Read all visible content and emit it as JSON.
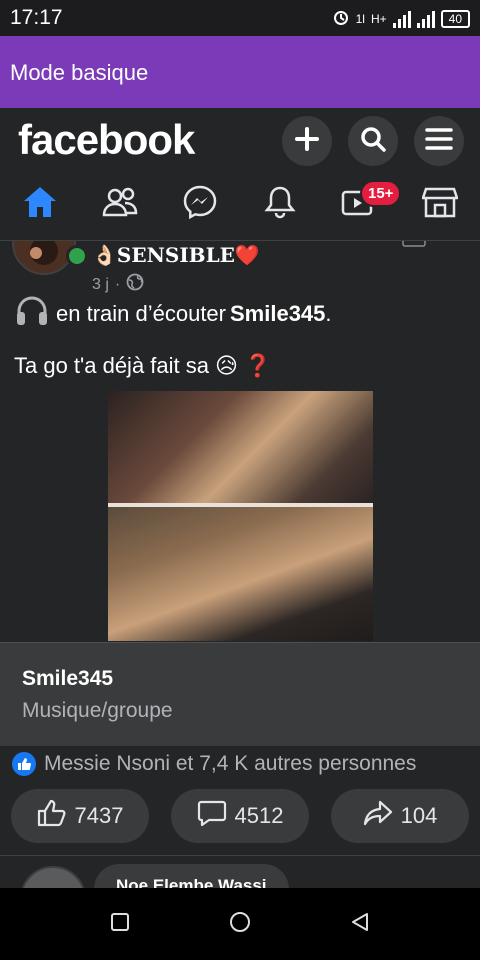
{
  "status_bar": {
    "time": "17:17",
    "network": "H+",
    "data": "1l",
    "battery": "40"
  },
  "mode_bar": {
    "label": "Mode basique"
  },
  "header": {
    "logo": "facebook",
    "actions": [
      "plus-icon",
      "search-icon",
      "menu-icon"
    ],
    "nav": [
      {
        "icon": "home-icon",
        "active": true
      },
      {
        "icon": "friends-icon"
      },
      {
        "icon": "messenger-icon"
      },
      {
        "icon": "bell-icon"
      },
      {
        "icon": "watch-icon",
        "badge": "15+"
      },
      {
        "icon": "marketplace-icon"
      }
    ]
  },
  "post": {
    "author": "SENSIBLE",
    "author_prefix_emoji": "👌🏻",
    "author_suffix_emoji": "❤️",
    "time": "3 j",
    "visibility": "public",
    "listening_text": "en train d’écouter",
    "listening_artist": "Smile345",
    "listening_period": ".",
    "body_text": "Ta go t'a déjà fait sa",
    "body_emoji_1": "😥",
    "body_emoji_2": "❓"
  },
  "link_card": {
    "name": "Smile345",
    "category": "Musique/groupe"
  },
  "reactions": {
    "summary": "Messie Nsoni et 7,4 K autres personnes"
  },
  "actions": {
    "like_count": "7437",
    "comment_count": "4512",
    "share_count": "104"
  },
  "next_post": {
    "author": "Noe Elembe Wassi"
  },
  "colors": {
    "mode_bar": "#7b3ab8",
    "background": "#242526",
    "accent": "#1877f2",
    "badge": "#e41e3f",
    "online": "#31a24c"
  }
}
